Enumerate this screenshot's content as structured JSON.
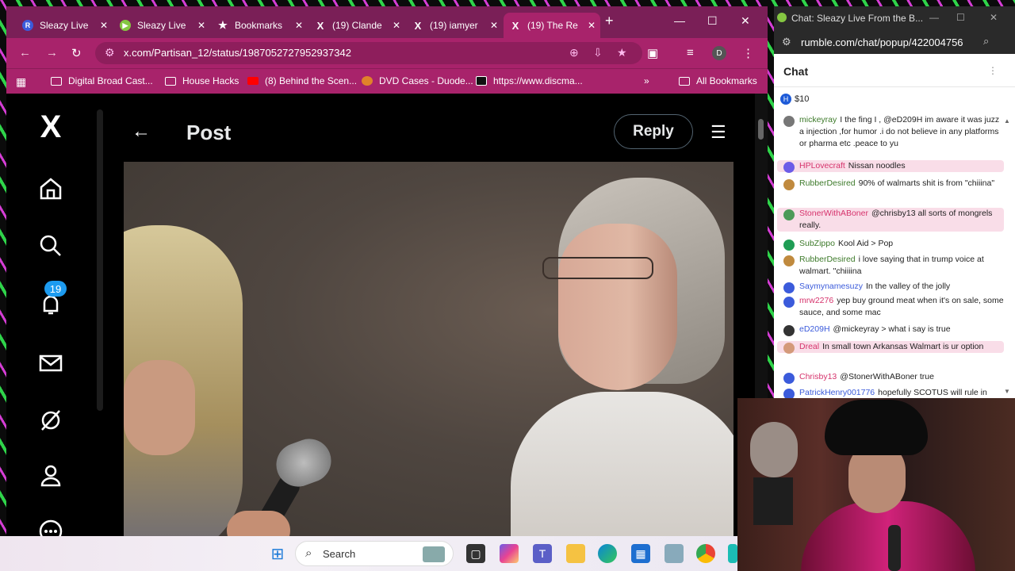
{
  "browser": {
    "tabs": [
      {
        "label": "Sleazy Live",
        "icon": "rumble-r-icon",
        "color": "#3b5bdb",
        "glyph": "R"
      },
      {
        "label": "Sleazy Live",
        "icon": "rumble-play-icon",
        "color": "#85c742",
        "glyph": "▶"
      },
      {
        "label": "Bookmarks",
        "icon": "star-icon",
        "color": "#ffffff",
        "glyph": "★"
      },
      {
        "label": "(19) Clande",
        "icon": "x-logo-icon",
        "color": "#ffffff",
        "glyph": "𝕏"
      },
      {
        "label": "(19) iamyer",
        "icon": "x-logo-icon",
        "color": "#ffffff",
        "glyph": "𝕏"
      },
      {
        "label": "(19) The Re",
        "icon": "x-logo-icon",
        "color": "#ffffff",
        "glyph": "𝕏"
      }
    ],
    "url": "x.com/Partisan_12/status/1987052727952937342",
    "bookmarks": [
      {
        "label": "Digital Broad Cast..."
      },
      {
        "label": "House Hacks"
      },
      {
        "label": "(8) Behind the Scen..."
      },
      {
        "label": "DVD Cases - Duode..."
      },
      {
        "label": "https://www.discma..."
      }
    ],
    "more_bookmarks": "»",
    "all_bookmarks": "All Bookmarks",
    "profile_initial": "D"
  },
  "x": {
    "notification_count": "19",
    "post_title": "Post",
    "reply_label": "Reply"
  },
  "taskbar": {
    "search_label": "Search"
  },
  "chat": {
    "window_title": "Chat: Sleazy Live From the B...",
    "address": "rumble.com/chat/popup/422004756",
    "header": "Chat",
    "rant_amount": "$10",
    "messages": [
      {
        "user": "mickeyray",
        "text": "I the fing I , @eD209H im aware it was juzz a injection ,for humor .i do not believe in any platforms or pharma etc .peace to yu",
        "color": "#3d7a2a",
        "av": "#777"
      },
      {
        "user": "HPLovecraft",
        "text": "Nissan noodles",
        "color": "#d6336c",
        "av": "#6c5ce7",
        "hl": true
      },
      {
        "user": "RubberDesired",
        "text": "90% of walmarts shit is from \"chiiina\"",
        "color": "#3d7a2a",
        "av": "#c08a3e"
      },
      {
        "user": "StonerWithABoner",
        "text": "@chrisby13 all sorts of mongrels really.",
        "color": "#d6336c",
        "av": "#4c9a58",
        "hl": true
      },
      {
        "user": "SubZippo",
        "text": "Kool Aid > Pop",
        "color": "#3d7a2a",
        "av": "#1f9d55"
      },
      {
        "user": "RubberDesired",
        "text": "i love saying that in trump voice at walmart. \"chiiiina",
        "color": "#3d7a2a",
        "av": "#c08a3e"
      },
      {
        "user": "Saymynamesuzy",
        "text": "In the valley of the jolly",
        "color": "#3b5bdb",
        "av": "#3b5bdb"
      },
      {
        "user": "mrw2276",
        "text": "yep buy ground meat when it's on sale, some sauce, and some mac",
        "color": "#d6336c",
        "av": "#3b5bdb"
      },
      {
        "user": "eD209H",
        "text": "@mickeyray > what i say is true",
        "color": "#3b5bdb",
        "av": "#333"
      },
      {
        "user": "Dreal",
        "text": "In small town Arkansas Walmart is ur option",
        "color": "#d6336c",
        "av": "#d49a7a",
        "hl": true
      },
      {
        "user": "Chrisby13",
        "text": "@StonerWithABoner true",
        "color": "#d6336c",
        "av": "#3b5bdb"
      },
      {
        "user": "PatrickHenry001776",
        "text": "hopefully SCOTUS will rule in",
        "color": "#3b5bdb",
        "av": "#3b5bdb"
      }
    ]
  }
}
